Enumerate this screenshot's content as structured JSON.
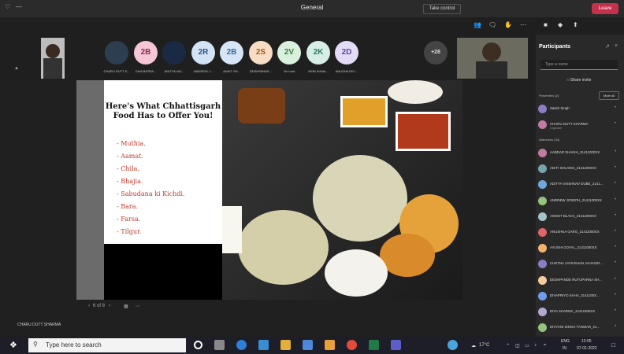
{
  "window": {
    "title": "General"
  },
  "toolbar": {
    "take_control": "Take control",
    "leave": "Leave"
  },
  "strip": {
    "avatars": [
      {
        "name": "CHARU DUTT S...",
        "color": "#2c3e50",
        "initials": "",
        "photo": true
      },
      {
        "name": "DIVA BATRA...",
        "color": "#f5c6d6",
        "initials": "2B",
        "text_color": "#8a2e52"
      },
      {
        "name": "ADITYA VAI...",
        "color": "#1b2a44",
        "initials": "",
        "photo": true
      },
      {
        "name": "ANDREW J...",
        "color": "#d2e3f5",
        "initials": "2R",
        "text_color": "#2b5a8c"
      },
      {
        "name": "ANKIT SH...",
        "color": "#d7e6f7",
        "initials": "2B",
        "text_color": "#3a68a0"
      },
      {
        "name": "DESHPANDE...",
        "color": "#f9dcc4",
        "initials": "2S",
        "text_color": "#a35a1e"
      },
      {
        "name": "On hold",
        "color": "#d8f0dc",
        "initials": "2V",
        "text_color": "#3a7d46"
      },
      {
        "name": "KENI KUMA...",
        "color": "#d5efe6",
        "initials": "2K",
        "text_color": "#2f7a62"
      },
      {
        "name": "ANUSHA DEL...",
        "color": "#e4dcf6",
        "initials": "2D",
        "text_color": "#5c44a0"
      }
    ],
    "more": "+28"
  },
  "slide": {
    "title": "Here's What Chhattisgarh Food Has to Offer You!",
    "items": [
      "Muthia.",
      "Aamat.",
      "Chila.",
      "Bhajia.",
      "Sabudana ki Kichdi.",
      "Bara.",
      "Farsa.",
      "Tilgur."
    ],
    "page": "6 of 8"
  },
  "presenter_label": "CHARU DUTT SHARMA",
  "panel": {
    "title": "Participants",
    "search_placeholder": "Type a name",
    "share_invite": "Share invite",
    "presenters_header": "Presenters (2)",
    "mute_all": "Mute all",
    "presenters": [
      {
        "name": "Satish Singh",
        "role": "",
        "color": "#8e7cc3"
      },
      {
        "name": "CHARU DUTT SHARMA",
        "role": "Organizer",
        "color": "#c27ba0"
      }
    ],
    "attendees_header": "Attendees (33)",
    "attendees": [
      {
        "name": "AABDAR SHAIKH_21411000XX",
        "color": "#c27ba0"
      },
      {
        "name": "ADITI SOLANKI_21411000XX",
        "color": "#76a5af"
      },
      {
        "name": "ADITYA VAISHNAV DUBE_2141...",
        "color": "#6fa8dc"
      },
      {
        "name": "ANDREW JOSEPH_21411000XX",
        "color": "#93c47d"
      },
      {
        "name": "ANIKET BLACK_21411000XX",
        "color": "#a2c4c9"
      },
      {
        "name": "ANUSHKA GARG_21411000XX",
        "color": "#e06666"
      },
      {
        "name": "AYUSHI GOYAL_21411000XX",
        "color": "#f6b26b"
      },
      {
        "name": "CHETNA JAYKISHAN JAHAGIR...",
        "color": "#8e7cc3"
      },
      {
        "name": "DESHPANDE RUTUPARNA SH...",
        "color": "#f9cb9c"
      },
      {
        "name": "DIVAPRIYO SAHA_2141100X...",
        "color": "#6d9eeb"
      },
      {
        "name": "DIVA SHARMA_21411000XX",
        "color": "#b4a7d6"
      },
      {
        "name": "DIVYANI SINGH TANWAR_21...",
        "color": "#93c47d"
      }
    ]
  },
  "taskbar": {
    "search_placeholder": "Type here to search",
    "weather": "17°C",
    "lang": "ENG",
    "region": "IN",
    "time": "12:05",
    "date": "07-01-2022"
  }
}
